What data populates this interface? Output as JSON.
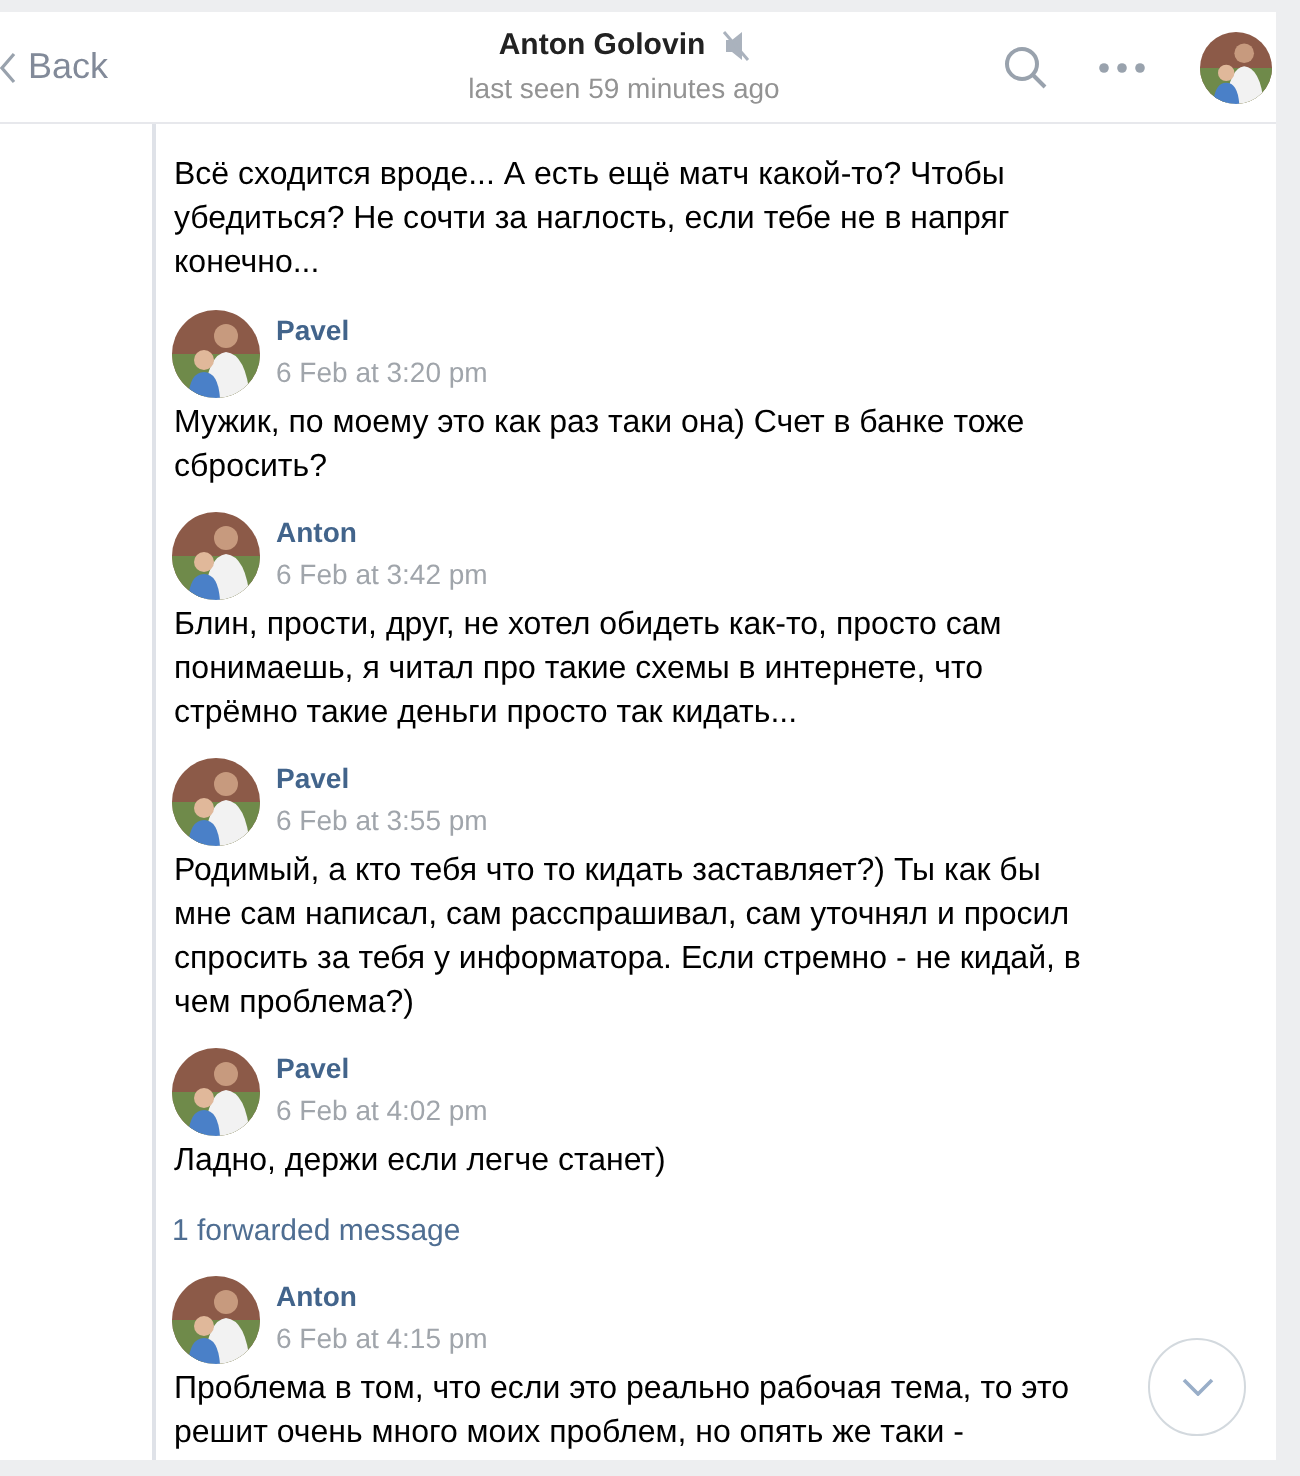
{
  "header": {
    "back": "Back",
    "title": "Anton Golovin",
    "muted": true,
    "status": "last seen 59 minutes ago"
  },
  "feed": [
    {
      "kind": "text",
      "lines": [
        "Всё сходится вроде... А есть ещё матч какой-то? Чтобы",
        "убедиться? Не сочти за наглость, если тебе не в напряг",
        "конечно..."
      ]
    },
    {
      "kind": "message",
      "name": "Pavel",
      "date": "6 Feb at 3:20 pm",
      "lines": [
        "Мужик, по моему это как раз таки она) Счет в банке тоже",
        "сбросить?"
      ]
    },
    {
      "kind": "message",
      "name": "Anton",
      "date": "6 Feb at 3:42 pm",
      "lines": [
        "Блин, прости, друг, не хотел обидеть как-то, просто сам",
        "понимаешь, я читал про такие схемы в интернете, что",
        "стрёмно такие деньги просто так кидать..."
      ]
    },
    {
      "kind": "message",
      "name": "Pavel",
      "date": "6 Feb at 3:55 pm",
      "lines": [
        "Родимый, а кто тебя что то кидать заставляет?) Ты как бы",
        "мне сам написал, сам расспрашивал, сам уточнял и просил",
        "спросить за тебя у информатора. Если стремно - не кидай, в",
        "чем проблема?)"
      ]
    },
    {
      "kind": "message",
      "name": "Pavel",
      "date": "6 Feb at 4:02 pm",
      "lines": [
        "Ладно, держи если легче станет)"
      ]
    },
    {
      "kind": "forwarded",
      "label": "1 forwarded message"
    },
    {
      "kind": "message",
      "name": "Anton",
      "date": "6 Feb at 4:15 pm",
      "lines": [
        "Проблема в том, что если это реально рабочая тема, то это",
        "решит очень много моих проблем, но опять же таки -"
      ]
    }
  ]
}
